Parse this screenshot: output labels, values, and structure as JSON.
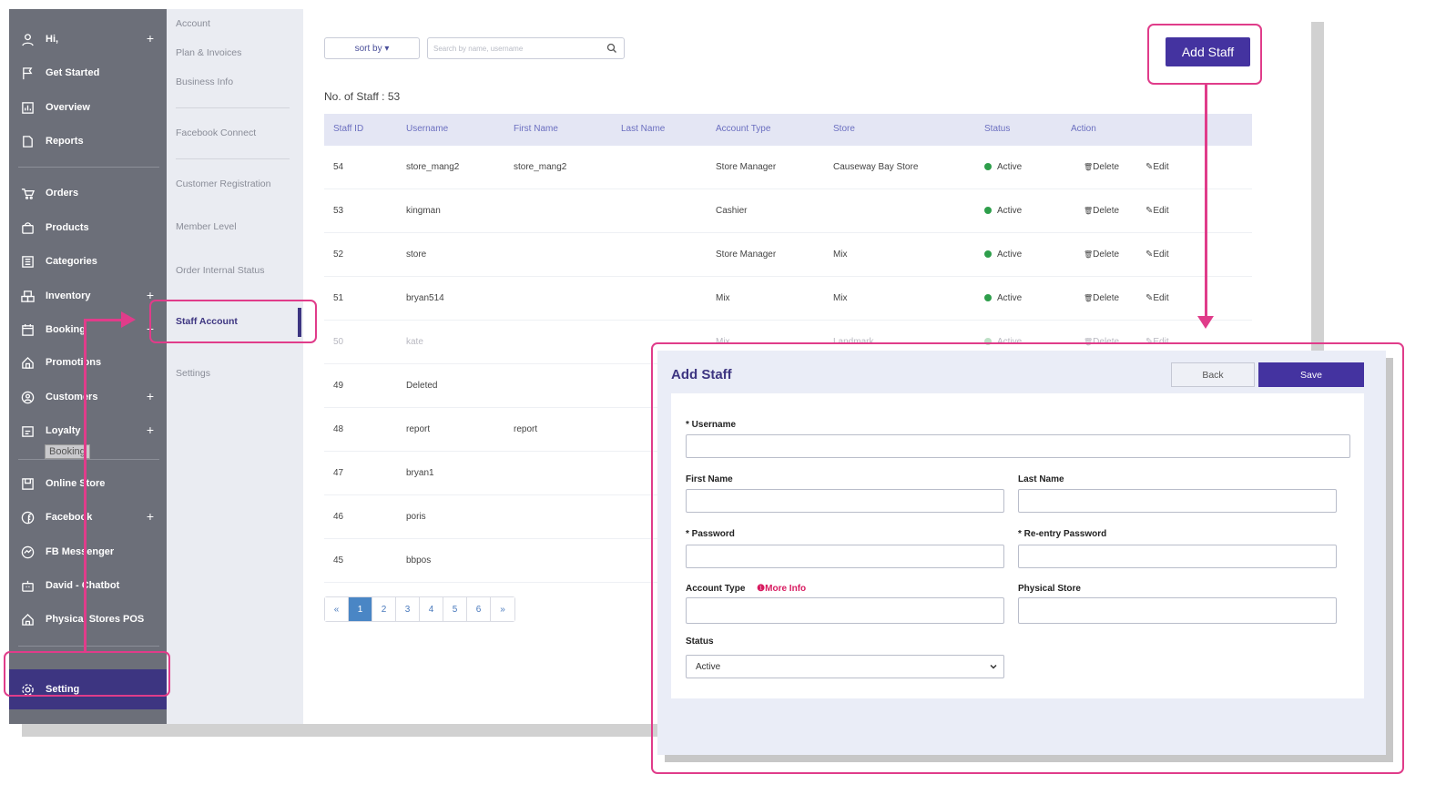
{
  "sidebar": {
    "items": [
      {
        "label": "Hi,",
        "icon": "user-icon",
        "plus": "+"
      },
      {
        "label": "Get Started",
        "icon": "flag-icon"
      },
      {
        "label": "Overview",
        "icon": "chart-icon"
      },
      {
        "label": "Reports",
        "icon": "document-icon"
      },
      {
        "label": "Orders",
        "icon": "cart-icon"
      },
      {
        "label": "Products",
        "icon": "bag-icon"
      },
      {
        "label": "Categories",
        "icon": "list-icon"
      },
      {
        "label": "Inventory",
        "icon": "boxes-icon",
        "plus": "+"
      },
      {
        "label": "Booking",
        "icon": "calendar-icon",
        "plus": "+"
      },
      {
        "label": "Promotions",
        "icon": "tag-icon"
      },
      {
        "label": "Customers",
        "icon": "customer-icon",
        "plus": "+"
      },
      {
        "label": "Loyalty",
        "icon": "loyalty-icon",
        "plus": "+"
      },
      {
        "label": "Online Store",
        "icon": "store-icon"
      },
      {
        "label": "Facebook",
        "icon": "facebook-icon",
        "plus": "+"
      },
      {
        "label": "FB Messenger",
        "icon": "messenger-icon"
      },
      {
        "label": "David - Chatbot",
        "icon": "robot-icon"
      },
      {
        "label": "Physical Stores POS",
        "icon": "pos-icon"
      }
    ],
    "setting_label": "Setting",
    "tooltip": "Booking"
  },
  "subnav": {
    "account": "Account",
    "plan": "Plan & Invoices",
    "business": "Business Info",
    "facebook": "Facebook Connect",
    "customer_reg": "Customer Registration",
    "member_level": "Member Level",
    "order_status": "Order Internal Status",
    "staff_account": "Staff Account",
    "settings": "Settings"
  },
  "toolbar": {
    "sort_label": "sort by ▾",
    "search_placeholder": "Search by name, username",
    "add_staff": "Add Staff"
  },
  "staff_count": "No. of Staff : 53",
  "table": {
    "headers": [
      "Staff ID",
      "Username",
      "First Name",
      "Last Name",
      "Account Type",
      "Store",
      "Status",
      "Action"
    ],
    "delete_label": "Delete",
    "edit_label": "Edit",
    "rows": [
      {
        "id": "54",
        "username": "store_mang2",
        "first": "store_mang2",
        "last": "",
        "type": "Store Manager",
        "store": "Causeway Bay Store",
        "status": "Active"
      },
      {
        "id": "53",
        "username": "kingman",
        "first": "",
        "last": "",
        "type": "Cashier",
        "store": "",
        "status": "Active"
      },
      {
        "id": "52",
        "username": "store",
        "first": "",
        "last": "",
        "type": "Store Manager",
        "store": "Mix",
        "status": "Active"
      },
      {
        "id": "51",
        "username": "bryan514",
        "first": "",
        "last": "",
        "type": "Mix",
        "store": "Mix",
        "status": "Active"
      },
      {
        "id": "50",
        "username": "kate",
        "first": "",
        "last": "",
        "type": "Mix",
        "store": "Landmark",
        "status": "Active"
      },
      {
        "id": "49",
        "username": "Deleted",
        "first": "",
        "last": "",
        "type": "",
        "store": "",
        "status": ""
      },
      {
        "id": "48",
        "username": "report",
        "first": "report",
        "last": "",
        "type": "",
        "store": "",
        "status": ""
      },
      {
        "id": "47",
        "username": "bryan1",
        "first": "",
        "last": "",
        "type": "",
        "store": "",
        "status": ""
      },
      {
        "id": "46",
        "username": "poris",
        "first": "",
        "last": "",
        "type": "",
        "store": "",
        "status": ""
      },
      {
        "id": "45",
        "username": "bbpos",
        "first": "",
        "last": "",
        "type": "",
        "store": "",
        "status": ""
      }
    ]
  },
  "pager": [
    "«",
    "1",
    "2",
    "3",
    "4",
    "5",
    "6",
    "»"
  ],
  "modal": {
    "title": "Add Staff",
    "back": "Back",
    "save": "Save",
    "username_label": "* Username",
    "first_label": "First Name",
    "last_label": "Last Name",
    "password_label": "* Password",
    "reentry_label": "* Re-entry Password",
    "account_type_label": "Account Type",
    "more_info": "❶More Info",
    "physical_store_label": "Physical Store",
    "status_label": "Status",
    "status_value": "Active"
  },
  "colors": {
    "primary": "#4433a0",
    "highlight": "#e03c8a",
    "sidebar": "#6c6f79",
    "active_status": "#2e9e4b"
  }
}
